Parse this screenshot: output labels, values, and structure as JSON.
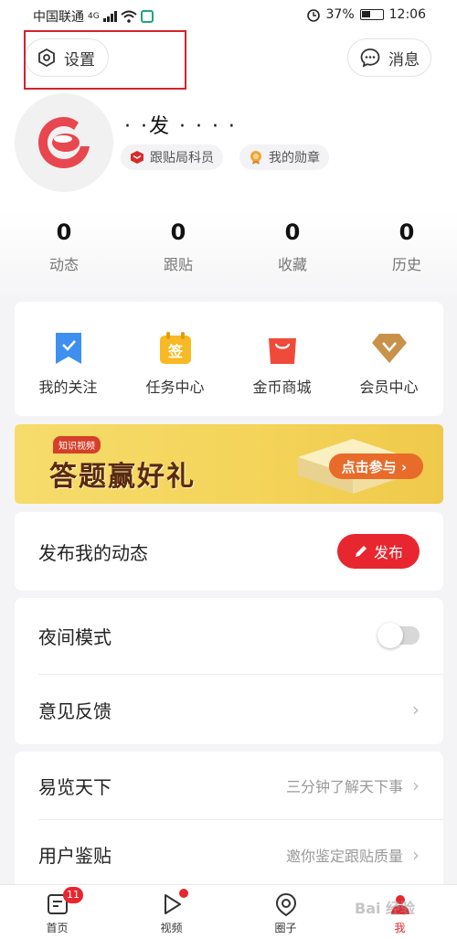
{
  "status_bar": {
    "carrier": "中国联通",
    "network": "4G",
    "battery": "37%",
    "time": "12:06"
  },
  "header": {
    "settings_label": "设置",
    "messages_label": "消息"
  },
  "profile": {
    "username": "· ·发 ·  ·  · ·",
    "badges": [
      {
        "label": "跟贴局科员",
        "icon": "red-badge-icon"
      },
      {
        "label": "我的勋章",
        "icon": "medal-icon"
      }
    ]
  },
  "stats": [
    {
      "value": "0",
      "label": "动态"
    },
    {
      "value": "0",
      "label": "跟贴"
    },
    {
      "value": "0",
      "label": "收藏"
    },
    {
      "value": "0",
      "label": "历史"
    }
  ],
  "shortcuts": [
    {
      "label": "我的关注",
      "icon": "bookmark-icon",
      "color": "#3f8ff0"
    },
    {
      "label": "任务中心",
      "icon": "task-sign-icon",
      "color": "#f7b924",
      "glyph": "签"
    },
    {
      "label": "金币商城",
      "icon": "shopping-bag-icon",
      "color": "#f04b3a"
    },
    {
      "label": "会员中心",
      "icon": "vip-diamond-icon",
      "color": "#c9924a"
    }
  ],
  "banner": {
    "tag": "知识视频",
    "title": "答题赢好礼",
    "button": "点击参与 ›"
  },
  "publish": {
    "label": "发布我的动态",
    "button": "发布"
  },
  "settings_rows": [
    {
      "label": "夜间模式",
      "toggle": false
    },
    {
      "label": "意见反馈"
    }
  ],
  "service_rows": [
    {
      "label": "易览天下",
      "hint": "三分钟了解天下事"
    },
    {
      "label": "用户鉴贴",
      "hint": "邀你鉴定跟贴质量"
    }
  ],
  "tabs": [
    {
      "label": "首页",
      "icon": "news-icon",
      "badge": "11"
    },
    {
      "label": "视频",
      "icon": "play-icon",
      "dot": true
    },
    {
      "label": "圈子",
      "icon": "circle-icon"
    },
    {
      "label": "我",
      "icon": "profile-icon",
      "active": true
    }
  ],
  "watermark": "Bai 经验",
  "colors": {
    "accent": "#e8262f",
    "highlight_box": "#d2232a"
  }
}
